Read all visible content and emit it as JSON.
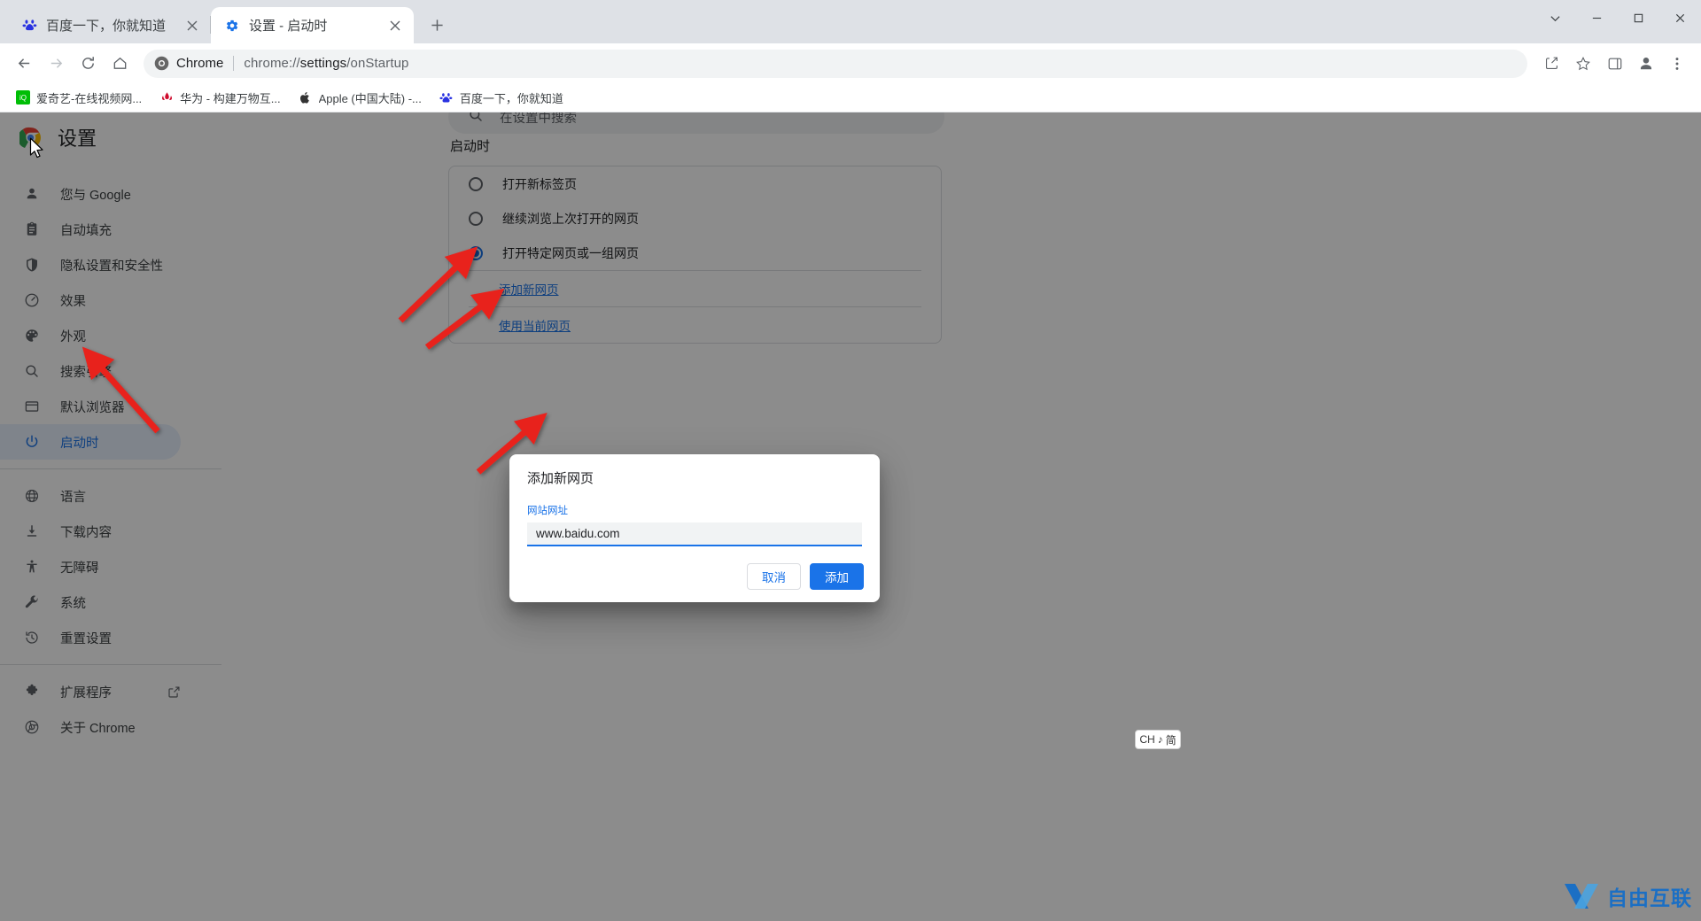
{
  "window": {
    "controls": [
      {
        "name": "chevron-down",
        "label": "⌄"
      },
      {
        "name": "minimize",
        "label": "─"
      },
      {
        "name": "maximize",
        "label": "□"
      },
      {
        "name": "close",
        "label": "✕"
      }
    ]
  },
  "tabs": [
    {
      "title": "百度一下，你就知道",
      "favicon": "baidu-icon",
      "active": false
    },
    {
      "title": "设置 - 启动时",
      "favicon": "settings-gear-icon",
      "active": true
    }
  ],
  "new_tab_label": "+",
  "toolbar": {
    "back": "←",
    "forward": "→",
    "reload": "↻",
    "home": "⌂",
    "omnibox": {
      "chip_label": "Chrome",
      "url_prefix": "chrome://",
      "url_bold": "settings",
      "url_suffix": "/onStartup"
    },
    "share_icon": "share-icon",
    "bookmark_icon": "star-icon",
    "sidepanel_icon": "side-panel-icon",
    "profile_icon": "profile-avatar-icon",
    "menu_icon": "three-dot-menu-icon"
  },
  "bookmarks": [
    {
      "label": "爱奇艺-在线视频网...",
      "icon": "iqiyi-icon",
      "color": "#00be06"
    },
    {
      "label": "华为 - 构建万物互...",
      "icon": "huawei-icon",
      "color": "#cf0a2c"
    },
    {
      "label": "Apple (中国大陆) -...",
      "icon": "apple-icon",
      "color": "#333333"
    },
    {
      "label": "百度一下，你就知道",
      "icon": "baidu-icon",
      "color": "#2932e1"
    }
  ],
  "settings": {
    "title": "设置",
    "search_placeholder": "在设置中搜索",
    "sidebar": [
      {
        "label": "您与 Google",
        "icon": "person-icon",
        "selected": false
      },
      {
        "label": "自动填充",
        "icon": "clipboard-icon",
        "selected": false
      },
      {
        "label": "隐私设置和安全性",
        "icon": "shield-icon",
        "selected": false
      },
      {
        "label": "效果",
        "icon": "speedometer-icon",
        "selected": false
      },
      {
        "label": "外观",
        "icon": "palette-icon",
        "selected": false
      },
      {
        "label": "搜索引擎",
        "icon": "search-icon",
        "selected": false
      },
      {
        "label": "默认浏览器",
        "icon": "browser-window-icon",
        "selected": false
      },
      {
        "label": "启动时",
        "icon": "power-icon",
        "selected": true
      },
      {
        "label": "语言",
        "icon": "globe-icon",
        "selected": false
      },
      {
        "label": "下载内容",
        "icon": "download-icon",
        "selected": false
      },
      {
        "label": "无障碍",
        "icon": "accessibility-icon",
        "selected": false
      },
      {
        "label": "系统",
        "icon": "wrench-icon",
        "selected": false
      },
      {
        "label": "重置设置",
        "icon": "restore-icon",
        "selected": false
      }
    ],
    "sidebar_footer": [
      {
        "label": "扩展程序",
        "icon": "puzzle-icon",
        "external": true
      },
      {
        "label": "关于 Chrome",
        "icon": "chrome-icon",
        "external": false
      }
    ],
    "section_heading": "启动时",
    "options": [
      {
        "label": "打开新标签页",
        "checked": false
      },
      {
        "label": "继续浏览上次打开的网页",
        "checked": false
      },
      {
        "label": "打开特定网页或一组网页",
        "checked": true
      }
    ],
    "links": [
      {
        "label": "添加新网页"
      },
      {
        "label": "使用当前网页"
      }
    ]
  },
  "dialog": {
    "title": "添加新网页",
    "field_label": "网站网址",
    "field_value": "www.baidu.com",
    "cancel_label": "取消",
    "confirm_label": "添加"
  },
  "ime": {
    "lang": "CH",
    "mode_icon": "♪",
    "mode": "简"
  },
  "watermark": {
    "text": "自由互联",
    "mark": "X"
  },
  "colors": {
    "accent": "#1a73e8",
    "tabstrip": "#dee1e6",
    "selected_nav_bg": "#e8f0fe",
    "arrow_red": "#e8231c",
    "scrim": "rgba(0,0,0,0.45)"
  }
}
